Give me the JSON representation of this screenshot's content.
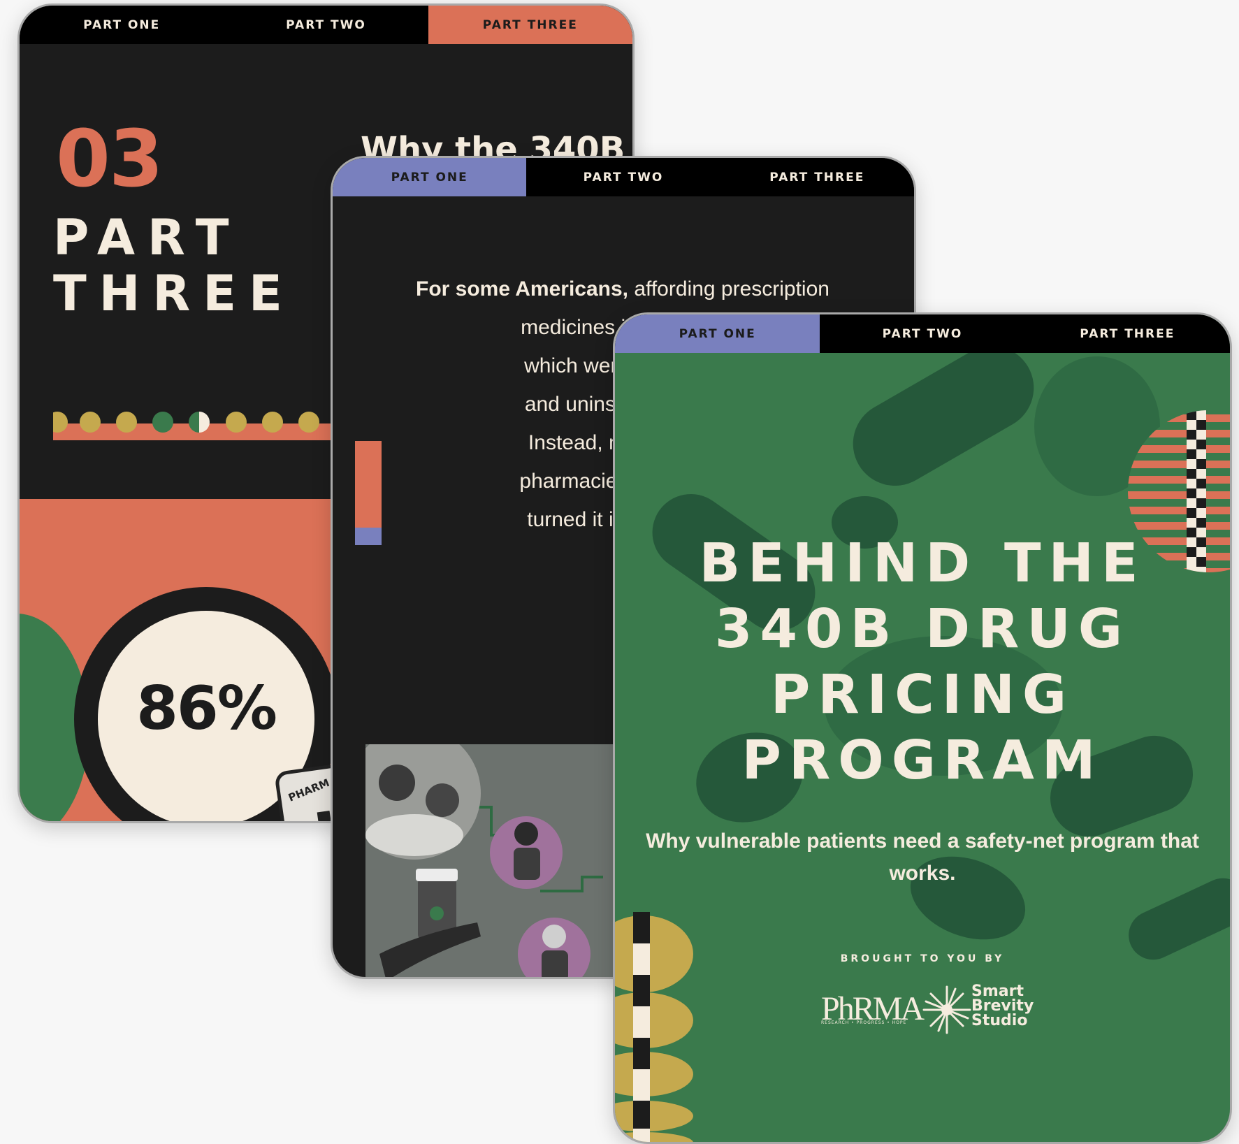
{
  "nav": {
    "tabs": [
      "PART ONE",
      "PART TWO",
      "PART THREE"
    ]
  },
  "card1": {
    "section_number": "03",
    "section_word1": "PART",
    "section_word2": "THREE",
    "heading_partial": "Why the 340B",
    "stat": "86%",
    "badge_text": "PHARM"
  },
  "card2": {
    "intro_bold": "For some Americans,",
    "intro_rest": " affording prescription",
    "lines": [
      "medicines is challengi",
      "which were initially m",
      "and uninsured patien",
      "Instead, many cover",
      "pharmacies have co-o",
      "turned it into one tha"
    ]
  },
  "card3": {
    "title_lines": [
      "BEHIND THE",
      "340B DRUG",
      "PRICING",
      "PROGRAM"
    ],
    "subtitle": "Why vulnerable patients need a safety-net program that works.",
    "brought_by": "BROUGHT TO YOU BY",
    "logo_phrma": "PhRMA",
    "logo_phrma_tagline": "RESEARCH • PROGRESS • HOPE",
    "logo_studio": [
      "Smart",
      "Brevity",
      "Studio"
    ]
  },
  "colors": {
    "orange": "#db7157",
    "blue": "#7980be",
    "green": "#3a7a4c",
    "dark": "#1c1c1c",
    "cream": "#f5ecde",
    "mustard": "#c5a94e"
  }
}
